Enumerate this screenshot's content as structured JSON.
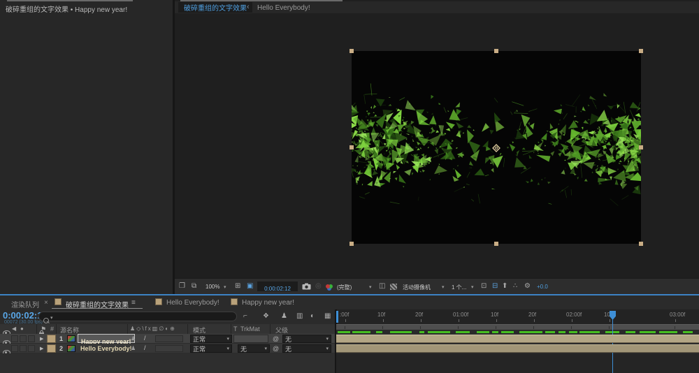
{
  "left_panel": {
    "tab": "破碎重组的文字效果 • Happy new year!"
  },
  "viewer": {
    "tab_active": "破碎重组的文字效果",
    "tab_secondary": "Hello Everybody!",
    "toolbar": {
      "zoom_level": "100%",
      "timecode": "0:00:02:12",
      "resolution": "(完整)",
      "camera_view": "活动摄像机",
      "view_count": "1 个...",
      "exposure": "+0.0"
    }
  },
  "timeline": {
    "tabs": {
      "render_queue": "渲染队列",
      "main": "破碎重组的文字效果",
      "second": "Hello Everybody!",
      "third": "Happy new year!"
    },
    "timecode": "0:00:02:12",
    "frame_info": "00072 (30.00 fps)",
    "headers": {
      "number": "#",
      "source_name": "源名称",
      "mode": "模式",
      "t": "T",
      "trkmat": "TrkMat",
      "parent": "父级"
    },
    "layers": [
      {
        "num": "1",
        "name": "Happy new year!",
        "mode": "正常",
        "trkmat": "",
        "parent": "无"
      },
      {
        "num": "2",
        "name": "Hello Everybody!",
        "mode": "正常",
        "trkmat": "无",
        "parent": "无"
      }
    ],
    "ruler_labels": [
      ":00f",
      "10f",
      "20f",
      "01:00f",
      "10f",
      "20f",
      "02:00f",
      "10f",
      "03:00f"
    ]
  },
  "glyphs": {
    "close": "×",
    "menu": "≡",
    "caret": "▾",
    "back": "‹",
    "bullet": "•",
    "arrow_right": "▶",
    "solo": "●",
    "audio": "◀",
    "label_flag": "⚑",
    "pickwhip": "@",
    "quality": "/",
    "shy": "♟",
    "flowchart": "⌐",
    "draft3d": "❖",
    "frame_blend": "▥",
    "motion_blur": "◐",
    "graph_editor": "▦",
    "grid": "⊞",
    "roi": "▣",
    "region": "◫",
    "gear": "⚙",
    "monitor": "⧉",
    "lockview": "❐",
    "viewlayout": "⊡",
    "pixelaspect": "⊟",
    "export": "⬆",
    "nodes": "∴"
  },
  "colors": {
    "accent_blue": "#4f9fe0",
    "cti_blue": "#3e8fd6",
    "cache_green": "#46bd20",
    "layer_bar_1": "#b3a685",
    "layer_bar_2": "#a29678",
    "handle_tan": "#c9ad85",
    "comp_black": "#050505",
    "particle_palette": [
      "#8fdf4a",
      "#7ed23f",
      "#66b82f",
      "#4c9623",
      "#356f18",
      "#244f10",
      "#9be55c",
      "#5ca52c"
    ]
  }
}
